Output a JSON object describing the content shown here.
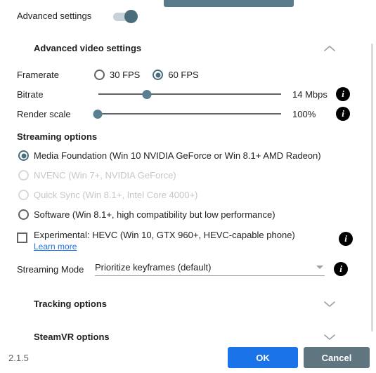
{
  "advanced": {
    "label": "Advanced settings",
    "toggle_state": "on"
  },
  "video_section": {
    "title": "Advanced video settings",
    "chevron": "chevron-up",
    "framerate": {
      "label": "Framerate",
      "options": [
        {
          "label": "30 FPS",
          "selected": false
        },
        {
          "label": "60 FPS",
          "selected": true
        }
      ]
    },
    "bitrate": {
      "label": "Bitrate",
      "value": "14 Mbps",
      "percent": 28
    },
    "render_scale": {
      "label": "Render scale",
      "value": "100%",
      "percent": 2
    }
  },
  "streaming_options": {
    "heading": "Streaming options",
    "options": [
      {
        "label": "Media Foundation (Win 10 NVIDIA GeForce or Win 8.1+ AMD Radeon)",
        "selected": true,
        "disabled": false
      },
      {
        "label": "NVENC (Win 7+, NVIDIA GeForce)",
        "selected": false,
        "disabled": true
      },
      {
        "label": "Quick Sync (Win 8.1+, Intel Core 4000+)",
        "selected": false,
        "disabled": true
      },
      {
        "label": "Software (Win 8.1+, high compatibility but low performance)",
        "selected": false,
        "disabled": false
      }
    ],
    "hevc": {
      "label": "Experimental: HEVC (Win 10, GTX 960+, HEVC-capable phone)",
      "link": "Learn more",
      "checked": false
    },
    "streaming_mode": {
      "label": "Streaming Mode",
      "value": "Prioritize keyframes (default)"
    }
  },
  "tracking_section": {
    "title": "Tracking options",
    "chevron": "chevron-down"
  },
  "steamvr_section": {
    "title": "SteamVR options",
    "chevron": "chevron-down"
  },
  "footer": {
    "version": "2.1.5",
    "ok": "OK",
    "cancel": "Cancel"
  },
  "icons": {
    "info": "i"
  },
  "colors": {
    "accent_blue": "#1a73e8",
    "slate": "#5a7a8a",
    "toggle_on": "#4a6d7c",
    "cancel_gray": "#5f7681"
  }
}
